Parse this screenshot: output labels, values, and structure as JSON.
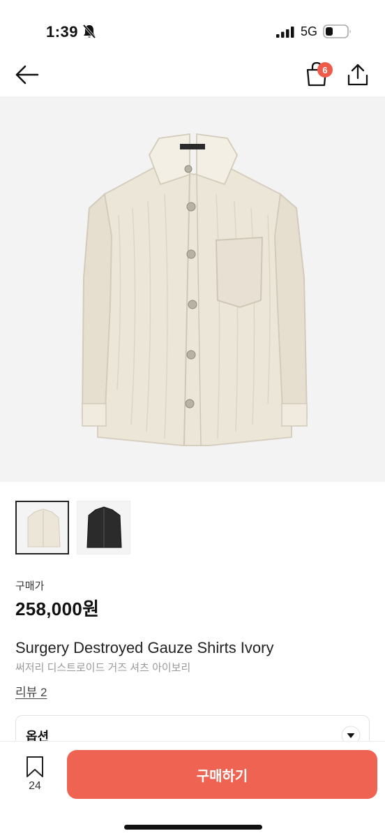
{
  "status_bar": {
    "time": "1:39",
    "network": "5G",
    "icons": [
      "bell-slash-icon",
      "signal-icon",
      "battery-icon"
    ]
  },
  "header": {
    "cart_count": "6",
    "icons": [
      "back-arrow-icon",
      "shopping-bag-icon",
      "share-icon"
    ]
  },
  "product": {
    "price_label": "구매가",
    "price": "258,000원",
    "name": "Surgery Destroyed Gauze Shirts Ivory",
    "name_kr": "써저리 디스트로이드 거즈 셔츠 아이보리",
    "review_link": "리뷰 2"
  },
  "options": {
    "label": "옵션"
  },
  "bottom": {
    "wish_count": "24",
    "buy_label": "구매하기"
  },
  "colors": {
    "accent": "#ef6353",
    "badge": "#ef5b4b",
    "hero_bg": "#f3f3f3"
  }
}
